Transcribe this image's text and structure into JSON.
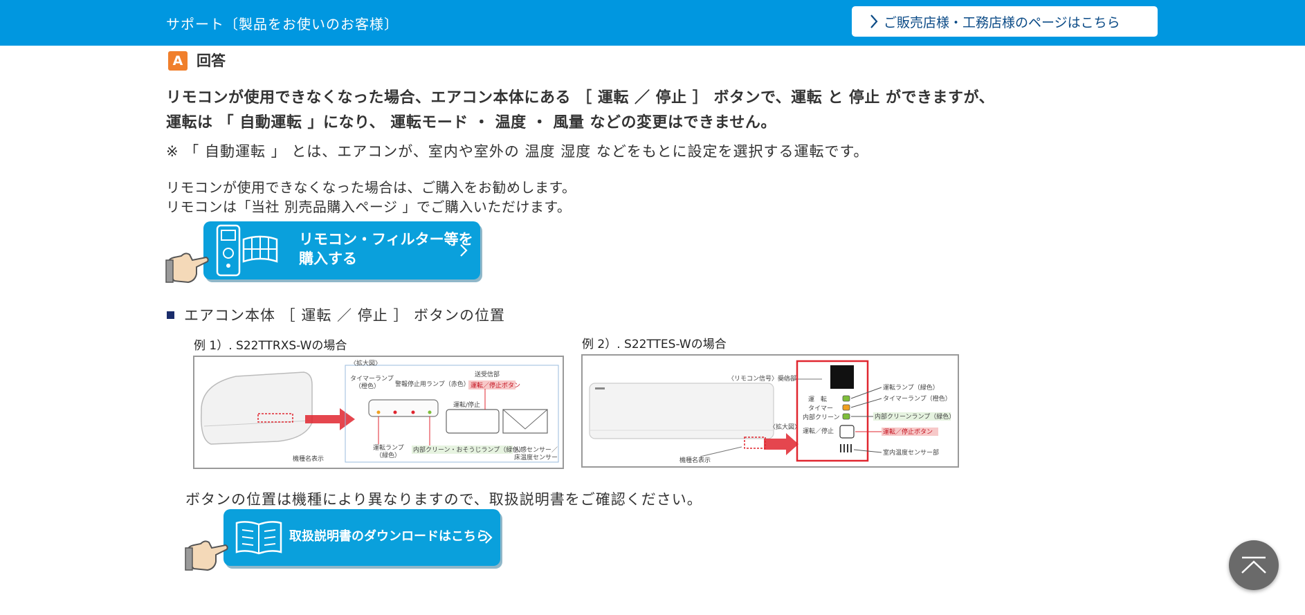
{
  "header": {
    "title": "サポート〔製品をお使いのお客様〕",
    "dealer_button": "ご販売店様・工務店様のページはこちら"
  },
  "answer": {
    "badge": "A",
    "label": "回答",
    "lead_line1": "リモコンが使用できなくなった場合、エアコン本体にある ［ 運転 ／ 停止 ］ ボタンで、運転 と 停止 ができますが、",
    "lead_line2": "運転は 「 自動運転 」になり、 運転モード ・ 温度 ・ 風量 などの変更はできません。",
    "note": "※ 「 自動運転 」 とは、エアコンが、室内や室外の 温度 湿度 などをもとに設定を選択する運転です。",
    "para_line1": "リモコンが使用できなくなった場合は、ご購入をお勧めします。",
    "para_line2": "リモコンは「当社 別売品購入ページ 」でご購入いただけます。"
  },
  "buy_button": {
    "line1": "リモコン・フィルター等を",
    "line2": "購入する"
  },
  "section": {
    "title": "エアコン本体 ［ 運転 ／ 停止 ］ ボタンの位置"
  },
  "example1": {
    "caption": "例 1）. S22TTRXS-Wの場合",
    "zoom_label": "〈拡大図〉",
    "timer_lamp": "タイマーランプ",
    "timer_lamp_color": "（橙色）",
    "signal_lamp": "警報停止用ランプ（赤色）",
    "receiver": "送受信部",
    "run_stop_button": "運転／停止ボタン",
    "run_lamp": "運転ランプ",
    "run_lamp_color": "（緑色）",
    "clean_lamp": "内部クリーン・おそうじランプ（緑色）",
    "sensor": "人感センサー／",
    "sensor2": "床温度センサー",
    "model_label": "機種名表示",
    "run_stop_small": "運転/停止"
  },
  "example2": {
    "caption": "例 2）. S22TTES-Wの場合",
    "receiver": "〈リモコン信号〉受信部",
    "zoom_label": "〈拡大図〉",
    "model_label": "機種名表示",
    "unten": "運　転",
    "timer": "タイマー",
    "clean": "内部クリーン",
    "run_stop": "運転／停止",
    "run_lamp": "運転ランプ（緑色）",
    "timer_lamp": "タイマーランプ（橙色）",
    "clean_lamp": "内部クリーンランプ（緑色）",
    "run_stop_button": "運転／停止ボタン",
    "temp_sensor": "室内温度センサー部"
  },
  "footnote": "ボタンの位置は機種により異なりますので、取扱説明書をご確認ください。",
  "manual_button": {
    "label": "取扱説明書のダウンロードはこちら"
  },
  "colors": {
    "header_bg": "#0097e0",
    "badge": "#f07f2c",
    "button": "#0aa0dc",
    "highlight_red": "#e0262f"
  },
  "icons": [
    "chevron-right-icon",
    "remote-control-icon",
    "filter-icon",
    "hand-pointer-icon",
    "book-icon",
    "arrow-up-icon"
  ]
}
